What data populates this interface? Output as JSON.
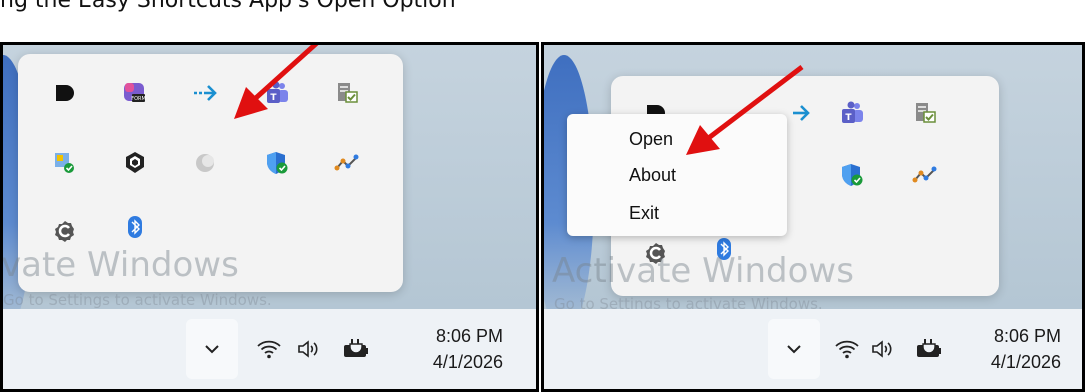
{
  "caption": "ng the Easy Shortcuts App's Open Option",
  "watermark": {
    "left_text": "vate Windows",
    "left_sub": "Go to Settings to activate Windows.",
    "right_text": "Activate Windows",
    "right_sub": "Go to Settings to activate Windows."
  },
  "tray_icons": [
    {
      "name": "dark-app-icon",
      "color": "#111111"
    },
    {
      "name": "copilot-app-icon",
      "color": "#7a5ccf",
      "badge": "FORM"
    },
    {
      "name": "easy-shortcuts-arrow-icon",
      "color": "#1a8fd0"
    },
    {
      "name": "teams-icon",
      "color": "#5b5fc7"
    },
    {
      "name": "task-list-icon",
      "color": "#6b8f3a"
    },
    {
      "name": "display-monitor-icon",
      "color": "#3c7fd6"
    },
    {
      "name": "shield-hex-icon",
      "color": "#222222"
    },
    {
      "name": "grey-circle-icon",
      "color": "#b0b0b0"
    },
    {
      "name": "defender-shield-icon",
      "color": "#2a6fd0"
    },
    {
      "name": "activity-graph-icon",
      "color": "#e08a20"
    },
    {
      "name": "settings-c-icon",
      "color": "#555555"
    },
    {
      "name": "bluetooth-icon",
      "color": "#2f7be0"
    }
  ],
  "context_menu": {
    "items": [
      "Open",
      "About",
      "Exit"
    ]
  },
  "taskbar": {
    "time": "8:06 PM",
    "date": "4/1/2026"
  },
  "colors": {
    "arrow": "#e01010",
    "flyout": "#f3f3f3"
  }
}
